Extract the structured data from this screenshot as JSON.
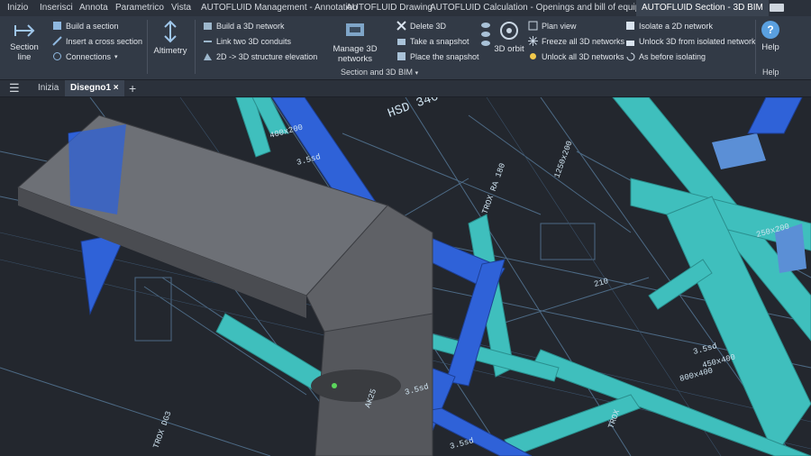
{
  "menu": {
    "tabs": [
      "Inizio",
      "Inserisci",
      "Annota",
      "Parametrico",
      "Vista",
      "AUTOFLUID Management - Annotation",
      "AUTOFLUID Drawing",
      "AUTOFLUID Calculation - Openings and bill of equipments",
      "AUTOFLUID Section - 3D BIM"
    ]
  },
  "ribbon": {
    "section_line": "Section line",
    "build_section": "Build a section",
    "insert_cross_section": "Insert a cross section",
    "connections": "Connections",
    "altimetry": "Altimetry",
    "build_3d_network": "Build a 3D network",
    "link_3d_conduits": "Link two 3D conduits",
    "structure_elevation": "2D -> 3D structure elevation",
    "manage_3d_networks": "Manage 3D networks",
    "delete_3d": "Delete 3D",
    "take_snapshot": "Take a snapshot",
    "place_snapshot": "Place the snapshot",
    "orbit_3d": "3D orbit",
    "plan_view": "Plan view",
    "freeze_all": "Freeze all 3D networks",
    "unlock_all": "Unlock all 3D networks",
    "isolate_2d": "Isolate a 2D network",
    "unlock_from_isolated": "Unlock 3D from isolated network",
    "as_before_isolating": "As before isolating",
    "help": "Help",
    "group_section_bim": "Section and 3D BIM",
    "group_help": "Help"
  },
  "doc_tabs": {
    "home": "Inizia",
    "active": "Disegno1",
    "add": "+"
  },
  "drawing": {
    "labels": {
      "hsd": "HSD 340",
      "ssd1": "3.5sd",
      "ssd2": "3.5sd",
      "ssd3": "3.5sd",
      "ssd4": "3.5sd",
      "n210": "210",
      "dim_250x200": "250x200",
      "dim_450x400": "450x400",
      "dim_400x200": "400x200",
      "dim_1250x200": "1250x200",
      "dim_800x400": "800x400",
      "troxa": "TROX RA 180",
      "troxb": "TROX DG3",
      "troxc": "TROX",
      "ak": "AK25"
    }
  },
  "colors": {
    "duct_gray": "#5f6166",
    "cyan": "#3fbfbd",
    "blue": "#2f62d8",
    "bg": "#23272e",
    "line": "#4d6a85"
  }
}
